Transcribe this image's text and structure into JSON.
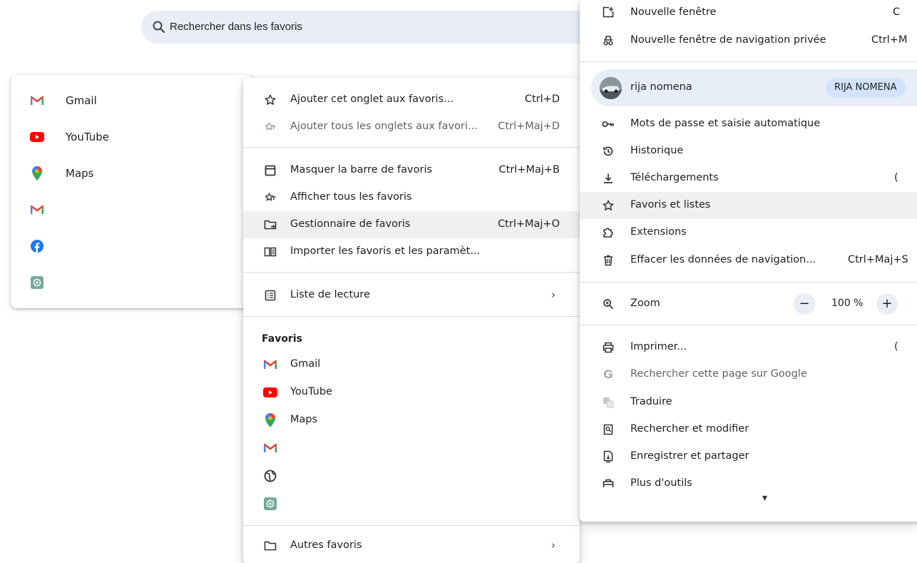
{
  "search": {
    "placeholder": "Rechercher dans les favoris",
    "icon": "search-icon"
  },
  "bookmarks_panel": {
    "items": [
      {
        "label": "Gmail",
        "icon": "gmail-icon"
      },
      {
        "label": "YouTube",
        "icon": "youtube-icon"
      },
      {
        "label": "Maps",
        "icon": "maps-icon"
      },
      {
        "label": "",
        "icon": "gmail-icon"
      },
      {
        "label": "",
        "icon": "facebook-icon"
      },
      {
        "label": "",
        "icon": "chatgpt-icon"
      }
    ]
  },
  "bookmarks_menu": {
    "items": [
      {
        "label": "Ajouter cet onglet aux favoris...",
        "shortcut": "Ctrl+D",
        "icon": "star-outline-icon"
      },
      {
        "label": "Ajouter tous les onglets aux favori...",
        "shortcut": "Ctrl+Maj+D",
        "icon": "stars-icon"
      },
      {
        "label": "Masquer la barre de favoris",
        "shortcut": "Ctrl+Maj+B",
        "icon": "bookmark-bar-icon"
      },
      {
        "label": "Afficher tous les favoris",
        "shortcut": "",
        "icon": "star-list-icon"
      },
      {
        "label": "Gestionnaire de favoris",
        "shortcut": "Ctrl+Maj+O",
        "icon": "folder-manager-icon"
      },
      {
        "label": "Importer les favoris et les paramèt...",
        "shortcut": "",
        "icon": "import-book-icon"
      },
      {
        "label": "Liste de lecture",
        "shortcut": "",
        "icon": "reading-list-icon"
      }
    ],
    "favorites_section_title": "Favoris",
    "favorites": [
      {
        "label": "Gmail",
        "icon": "gmail-icon"
      },
      {
        "label": "YouTube",
        "icon": "youtube-icon"
      },
      {
        "label": "Maps",
        "icon": "maps-icon"
      },
      {
        "label": "",
        "icon": "gmail-icon"
      },
      {
        "label": "",
        "icon": "globe-icon"
      },
      {
        "label": "",
        "icon": "chatgpt-icon"
      }
    ],
    "other_favorites": "Autres favoris",
    "chevron": "›"
  },
  "chrome_menu": {
    "new_window": {
      "label": "Nouvelle fenêtre",
      "shortcut": "C"
    },
    "incognito": {
      "label": "Nouvelle fenêtre de navigation privée",
      "shortcut": "Ctrl+M"
    },
    "profile": {
      "name": "rija nomena",
      "chip": "RIJA NOMENA"
    },
    "passwords": "Mots de passe et saisie automatique",
    "history": "Historique",
    "downloads": {
      "label": "Téléchargements",
      "shortcut": "("
    },
    "bookmarks": "Favoris et listes",
    "extensions": "Extensions",
    "clear_data": {
      "label": "Effacer les données de navigation...",
      "shortcut": "Ctrl+Maj+S"
    },
    "zoom": {
      "label": "Zoom",
      "minus": "−",
      "value": "100 %",
      "plus": "+"
    },
    "print": {
      "label": "Imprimer...",
      "shortcut": "("
    },
    "google_search": "Rechercher cette page sur Google",
    "translate": "Traduire",
    "find": "Rechercher et modifier",
    "save_share": "Enregistrer et partager",
    "more_tools": "Plus d'outils",
    "scroll_arrow": "▾"
  }
}
